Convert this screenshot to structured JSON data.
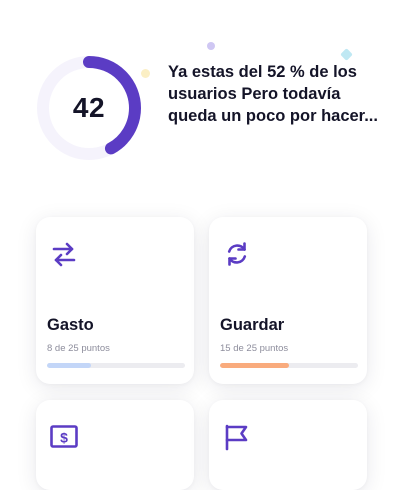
{
  "score": {
    "value": "42",
    "progress_fraction": 0.42,
    "ring_color": "#5b3cc4",
    "track_color": "#f5f3fc"
  },
  "message": {
    "text": "Ya estas del 52 % de los usuarios Pero todavía queda un poco por hacer..."
  },
  "cards": [
    {
      "name": "Gasto",
      "subtitle": "8 de 25 puntos",
      "progress": 0.32,
      "bar_color": "#c3d6f8",
      "icon": "swap-arrows-icon"
    },
    {
      "name": "Guardar",
      "subtitle": "15 de 25 puntos",
      "progress": 0.5,
      "bar_color": "#f9ab7d",
      "icon": "refresh-icon"
    },
    {
      "icon": "dollar-bill-icon"
    },
    {
      "icon": "flag-icon"
    }
  ],
  "accent_color": "#5b3cc4"
}
